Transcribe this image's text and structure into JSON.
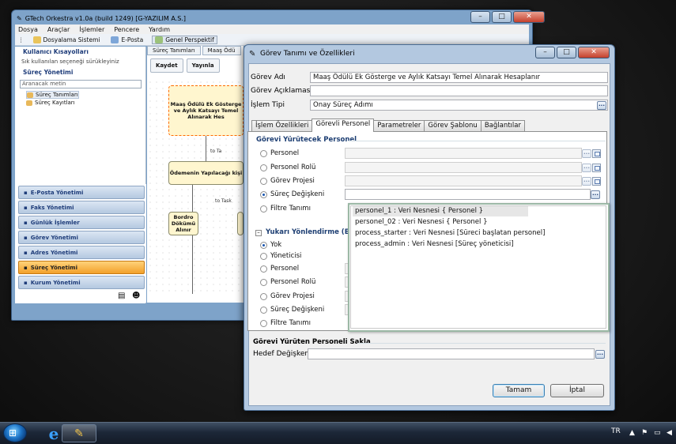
{
  "app": {
    "title": "GTech Orkestra v1.0a (build 1249) [G-YAZILIM A.S.]",
    "menu": [
      "Dosya",
      "Araçlar",
      "İşlemler",
      "Pencere",
      "Yardım"
    ],
    "toolbar": [
      "Dosyalama Sistemi",
      "E-Posta",
      "Genel Perspektif"
    ],
    "left": {
      "shortcuts_title": "Kullanıcı Kısayolları",
      "shortcuts_hint": "Sık kullanılan seçeneği sürükleyiniz",
      "process_title": "Süreç Yönetimi",
      "search_placeholder": "Aranacak metin",
      "tree": [
        "Süreç Tanımları",
        "Süreç Kayıtları"
      ]
    },
    "nav": [
      "E-Posta Yönetimi",
      "Faks Yönetimi",
      "Günlük İşlemler",
      "Görev Yönetimi",
      "Adres Yönetimi",
      "Süreç Yönetimi",
      "Kurum Yönetimi"
    ],
    "canvas_tabs": [
      "Süreç Tanımları",
      "Maaş Ödü"
    ],
    "canvas_tools": [
      "Kaydet",
      "Yayınla"
    ],
    "nodes": [
      "Maaş Ödülü Ek Gösterge ve Aylık Katsayı Temel Alınarak Hes",
      "Ödemenin Yapılacağı kişi",
      "Bordro Dökümü Alınır"
    ],
    "edge_labels": [
      "to Ta",
      "to Task"
    ]
  },
  "dialog": {
    "title": "Görev Tanımı ve Özellikleri",
    "fields": {
      "gorev_adi_label": "Görev Adı",
      "gorev_adi_value": "Maaş Ödülü Ek Gösterge ve Aylık Katsayı Temel Alınarak Hesaplanır",
      "gorev_aciklamasi_label": "Görev Açıklaması",
      "gorev_aciklamasi_value": "",
      "islem_tipi_label": "İşlem Tipi",
      "islem_tipi_value": "Onay Süreç Adımı"
    },
    "tabs": [
      "İşlem Özellikleri",
      "Görevli Personel",
      "Parametreler",
      "Görev Şablonu",
      "Bağlantılar"
    ],
    "active_tab": "Görevli Personel",
    "group1_title": "Görevi Yürütecek Personel",
    "group1_options": [
      "Personel",
      "Personel Rolü",
      "Görev Projesi",
      "Süreç Değişkeni",
      "Filtre Tanımı"
    ],
    "group1_selected": "Süreç Değişkeni",
    "group2_title": "Yukarı Yönlendirme (Eska",
    "group2_options": [
      "Yok",
      "Yöneticisi",
      "Personel",
      "Personel Rolü",
      "Görev Projesi",
      "Süreç Değişkeni",
      "Filtre Tanımı"
    ],
    "group2_selected": "Yok",
    "dropdown_items": [
      "personel_1 : Veri Nesnesi { Personel }",
      "personel_02 : Veri Nesnesi { Personel }",
      "process_starter : Veri Nesnesi [Süreci başlatan personel]",
      "process_admin : Veri Nesnesi [Süreç yöneticisi]"
    ],
    "group3_title": "Görevi Yürüten Personeli Sakla",
    "hedef_label": "Hedef Değişken",
    "hedef_value": "",
    "ok_button": "Tamam",
    "cancel_button": "İptal",
    "ellipsis": "..."
  },
  "taskbar": {
    "language": "TR",
    "start_icon": "windows-orb",
    "pinned": [
      "internet-explorer-icon",
      "gtech-orkestra-icon"
    ]
  },
  "colors": {
    "accent": "#1e3f73",
    "nav_active": "#f2a02a",
    "taskbar": "#1c2738"
  }
}
